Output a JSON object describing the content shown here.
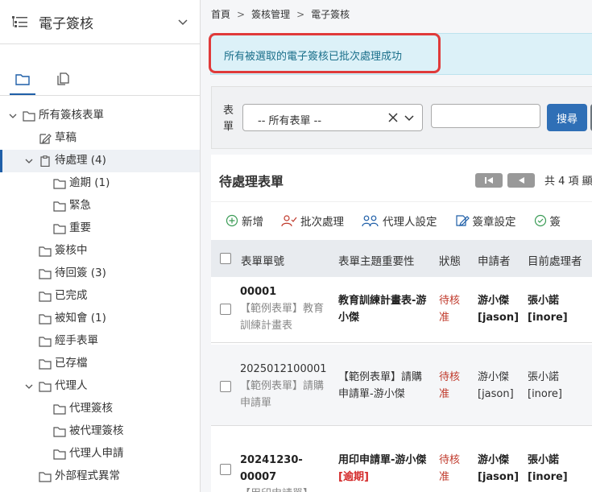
{
  "sidebar": {
    "title": "電子簽核",
    "tree": [
      {
        "label": "所有簽核表單",
        "level": 0,
        "icon": "folder-icon",
        "chevron": true
      },
      {
        "label": "草稿",
        "level": 1,
        "icon": "edit-icon",
        "chevron": false
      },
      {
        "label": "待處理 (4)",
        "level": 1,
        "icon": "clipboard-icon",
        "chevron": true,
        "active": true
      },
      {
        "label": "逾期 (1)",
        "level": 2,
        "icon": "folder-icon",
        "chevron": false
      },
      {
        "label": "緊急",
        "level": 2,
        "icon": "folder-icon",
        "chevron": false
      },
      {
        "label": "重要",
        "level": 2,
        "icon": "folder-icon",
        "chevron": false
      },
      {
        "label": "簽核中",
        "level": 1,
        "icon": "folder-icon",
        "chevron": false
      },
      {
        "label": "待回簽 (3)",
        "level": 1,
        "icon": "folder-icon",
        "chevron": false
      },
      {
        "label": "已完成",
        "level": 1,
        "icon": "folder-icon",
        "chevron": false
      },
      {
        "label": "被知會 (1)",
        "level": 1,
        "icon": "folder-icon",
        "chevron": false
      },
      {
        "label": "經手表單",
        "level": 1,
        "icon": "folder-icon",
        "chevron": false
      },
      {
        "label": "已存檔",
        "level": 1,
        "icon": "folder-icon",
        "chevron": false
      },
      {
        "label": "代理人",
        "level": 1,
        "icon": "folder-icon",
        "chevron": true
      },
      {
        "label": "代理簽核",
        "level": 2,
        "icon": "folder-icon",
        "chevron": false
      },
      {
        "label": "被代理簽核",
        "level": 2,
        "icon": "folder-icon",
        "chevron": false
      },
      {
        "label": "代理人申請",
        "level": 2,
        "icon": "folder-icon",
        "chevron": false
      },
      {
        "label": "外部程式異常",
        "level": 1,
        "icon": "folder-icon",
        "chevron": false
      }
    ]
  },
  "breadcrumb": [
    "首頁",
    "簽核管理",
    "電子簽核"
  ],
  "alert": {
    "text": "所有被選取的電子簽核已批次處理成功"
  },
  "filter": {
    "label": "表單",
    "select_value": "-- 所有表單 --",
    "search_value": "",
    "search_button": "搜尋"
  },
  "list": {
    "title": "待處理表單",
    "count_text": "共 4 項 顯"
  },
  "toolbar": [
    "新增",
    "批次處理",
    "代理人設定",
    "簽章設定",
    "簽"
  ],
  "table": {
    "headers": {
      "form_no": "表單單號",
      "subject": "表單主題重要性",
      "status": "狀態",
      "applicant": "申請者",
      "handler": "目前處理者"
    },
    "rows": [
      {
        "no": "00001",
        "sub": "【範例表單】教育訓練計畫表",
        "subject": "教育訓練計畫表-游小傑",
        "subject_flag": "",
        "status": "待核准",
        "applicant": "游小傑 [jason]",
        "handler": "張小諾 [inore]",
        "bold": true
      },
      {
        "no": "2025012100001",
        "sub": "【範例表單】請購申請單",
        "subject": "【範例表單】請購申請單-游小傑",
        "subject_flag": "",
        "status": "待核准",
        "applicant": "游小傑 [jason]",
        "handler": "張小諾 [inore]",
        "bold": false
      },
      {
        "no": "20241230-00007",
        "sub": "【用印申請單】",
        "subject": "用印申請單-游小傑",
        "subject_flag": "[逾期]",
        "status": "待核准",
        "applicant": "游小傑 [jason]",
        "handler": "張小諾 [inore]",
        "bold": true
      }
    ]
  },
  "colors": {
    "accent": "#2f6fb6",
    "alert_bg": "#dcf1f8",
    "alert_text": "#1a6f8a",
    "highlight": "#e03a3a",
    "status_red": "#c0392b"
  }
}
